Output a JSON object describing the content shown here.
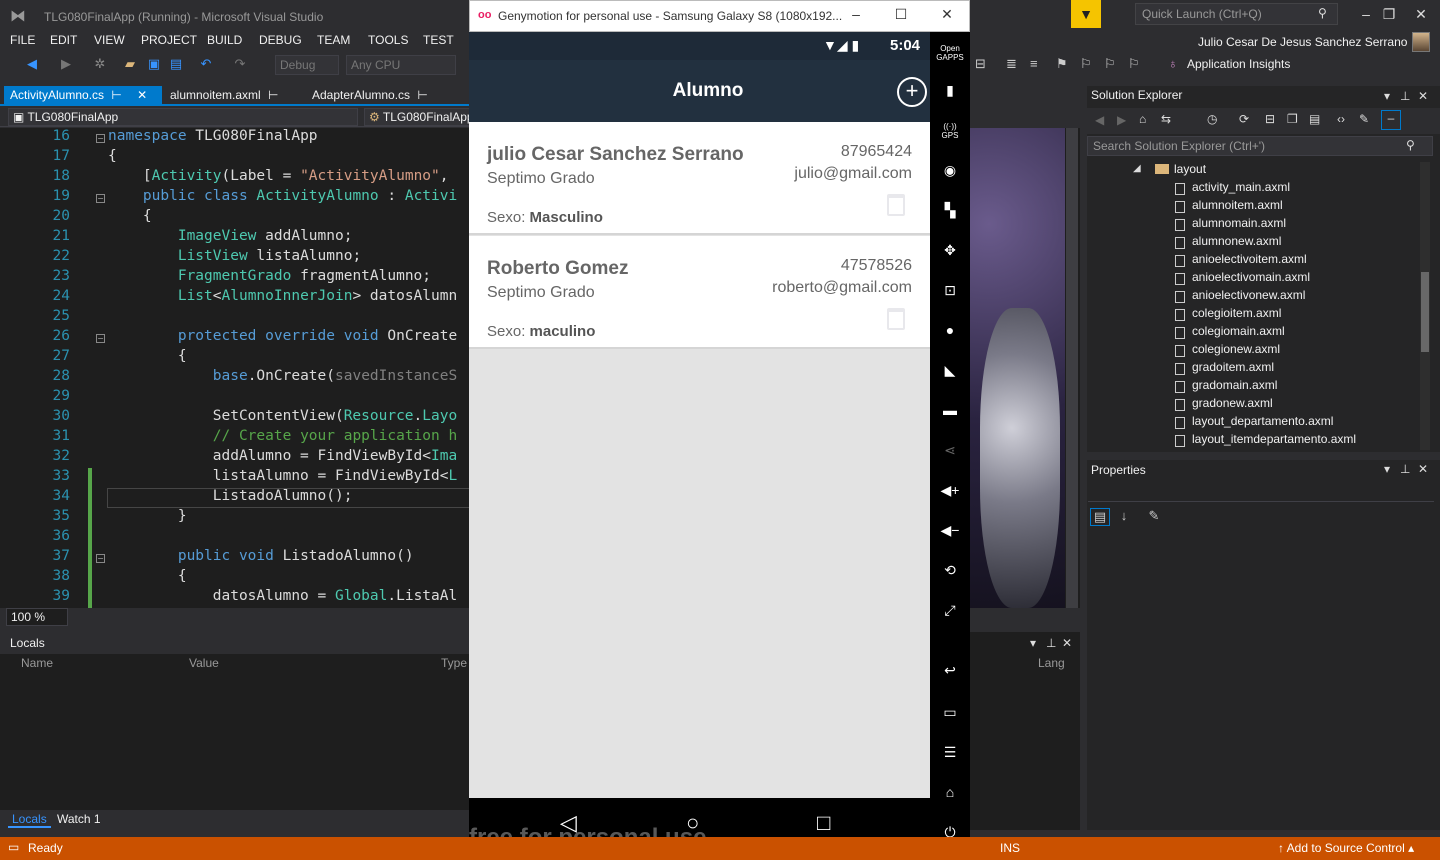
{
  "titlebar": {
    "app_title": "TLG080FinalApp (Running) - Microsoft Visual Studio",
    "quick_launch_placeholder": "Quick Launch (Ctrl+Q)",
    "user_name": "Julio Cesar De Jesus Sanchez Serrano"
  },
  "menu": [
    "FILE",
    "EDIT",
    "VIEW",
    "PROJECT",
    "BUILD",
    "DEBUG",
    "TEAM",
    "TOOLS",
    "TEST"
  ],
  "toolbar": {
    "config": "Debug",
    "platform": "Any CPU",
    "application_insights": "Application Insights"
  },
  "tabs": [
    {
      "label": "ActivityAlumno.cs",
      "active": true
    },
    {
      "label": "alumnoitem.axml",
      "active": false
    },
    {
      "label": "AdapterAlumno.cs",
      "active": false
    }
  ],
  "navbar": {
    "project": "TLG080FinalApp",
    "member": "TLG080FinalApp"
  },
  "editor": {
    "line_numbers": [
      "16",
      "17",
      "18",
      "19",
      "20",
      "21",
      "22",
      "23",
      "24",
      "25",
      "26",
      "27",
      "28",
      "29",
      "30",
      "31",
      "32",
      "33",
      "34",
      "35",
      "36",
      "37",
      "38",
      "39"
    ],
    "zoom": "100 %"
  },
  "locals": {
    "title": "Locals",
    "columns": [
      "Name",
      "Value",
      "Type",
      "Lang"
    ],
    "tabs": [
      "Locals",
      "Watch 1"
    ]
  },
  "status": {
    "ready": "Ready",
    "ins": "INS",
    "source_control": "Add to Source Control"
  },
  "solution_explorer": {
    "title": "Solution Explorer",
    "search_placeholder": "Search Solution Explorer (Ctrl+')",
    "folder": "layout",
    "files": [
      "activity_main.axml",
      "alumnoitem.axml",
      "alumnomain.axml",
      "alumnonew.axml",
      "anioelectivoitem.axml",
      "anioelectivomain.axml",
      "anioelectivonew.axml",
      "colegioitem.axml",
      "colegiomain.axml",
      "colegionew.axml",
      "gradoitem.axml",
      "gradomain.axml",
      "gradonew.axml",
      "layout_departamento.axml",
      "layout_itemdepartamento.axml"
    ]
  },
  "properties": {
    "title": "Properties"
  },
  "emulator": {
    "title": "Genymotion for personal use - Samsung Galaxy S8 (1080x192...",
    "time": "5:04",
    "screen_title": "Alumno",
    "watermark": "free for personal use",
    "students": [
      {
        "name": "julio Cesar Sanchez Serrano",
        "grade": "Septimo Grado",
        "phone": "87965424",
        "email": "julio@gmail.com",
        "sex_label": "Sexo:",
        "sex": "Masculino"
      },
      {
        "name": "Roberto Gomez",
        "grade": "Septimo Grado",
        "phone": "47578526",
        "email": "roberto@gmail.com",
        "sex_label": "Sexo:",
        "sex": "maculino"
      }
    ],
    "side_icons": [
      "opengapps-icon",
      "battery-icon",
      "gps-icon",
      "camera-icon",
      "clapper-icon",
      "move-icon",
      "id-icon",
      "record-icon",
      "rss-icon",
      "sms-icon",
      "share-icon",
      "volume-up-icon",
      "volume-down-icon",
      "rotate-icon",
      "scale-icon",
      "back-icon",
      "recent-apps-icon",
      "menu-icon",
      "home-icon",
      "power-icon"
    ]
  },
  "colors": {
    "accent": "#007acc",
    "status_bar": "#ca5100",
    "phone_bar": "#22303f"
  }
}
